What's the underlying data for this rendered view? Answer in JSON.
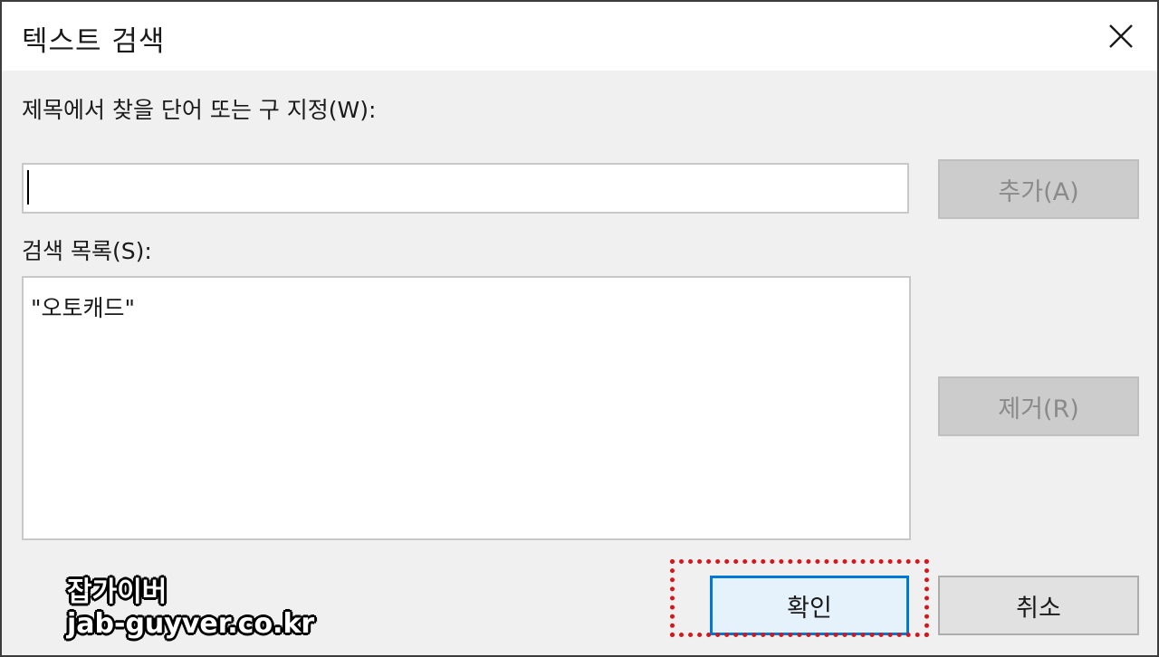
{
  "window": {
    "title": "텍스트 검색"
  },
  "form": {
    "prompt_label": "제목에서 찾을 단어 또는 구 지정(W):",
    "word_input_value": "",
    "list_label": "검색 목록(S):",
    "list_items": [
      "\"오토캐드\""
    ]
  },
  "buttons": {
    "add_label": "추가(A)",
    "remove_label": "제거(R)",
    "ok_label": "확인",
    "cancel_label": "취소"
  },
  "watermark": {
    "line1": "잡가이버",
    "line2": "jab-guyver.co.kr"
  },
  "colors": {
    "highlight": "#d9141b",
    "default_button_border": "#0078d7"
  },
  "icons": {
    "close": "close-icon"
  }
}
